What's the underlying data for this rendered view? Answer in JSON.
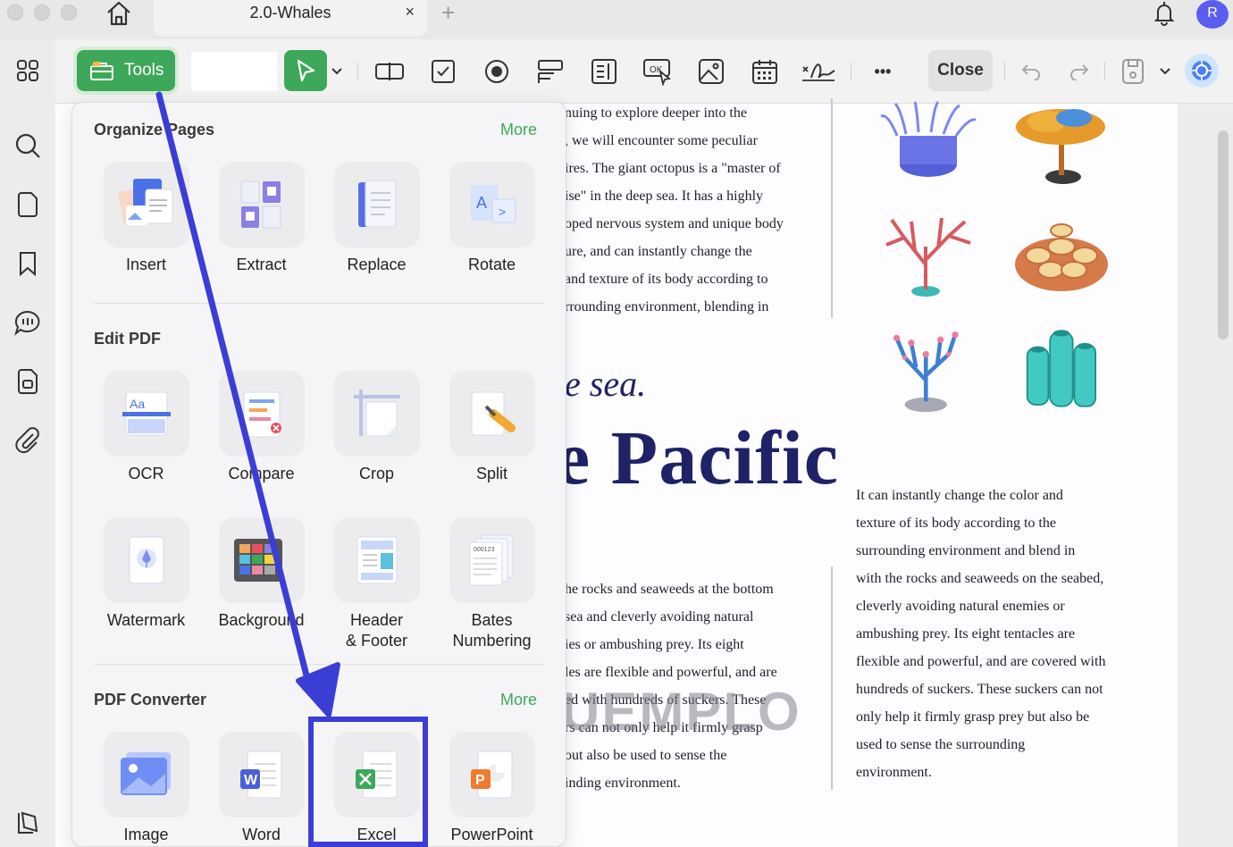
{
  "titlebar": {
    "tab_title": "2.0-Whales",
    "tab_close": "×",
    "new_tab": "+",
    "avatar_letter": "R",
    "icons": [
      "home-icon",
      "bell-icon"
    ]
  },
  "toolbar": {
    "tools_label": "Tools",
    "close_label": "Close",
    "more_label": "•••",
    "icons": [
      "select-arrow-icon",
      "text-field-icon",
      "checkbox-icon",
      "radio-button-icon",
      "combo-box-icon",
      "list-box-icon",
      "button-icon",
      "image-field-icon",
      "date-field-icon",
      "signature-field-icon",
      "undo-icon",
      "redo-icon",
      "save-icon",
      "ai-assistant-icon"
    ]
  },
  "rail": {
    "icons": [
      "grid-icon",
      "search-icon",
      "page-icon",
      "bookmark-icon",
      "comment-icon",
      "attachment-page-icon",
      "paperclip-icon",
      "layers-icon"
    ]
  },
  "panel": {
    "organize": {
      "title": "Organize Pages",
      "more": "More",
      "tools": [
        "Insert",
        "Extract",
        "Replace",
        "Rotate"
      ]
    },
    "edit": {
      "title": "Edit PDF",
      "tools": [
        "OCR",
        "Compare",
        "Crop",
        "Split",
        "Watermark",
        "Background",
        "Header\n& Footer",
        "Bates\nNumbering"
      ]
    },
    "converter": {
      "title": "PDF Converter",
      "more": "More",
      "tools": [
        "Image",
        "Word",
        "Excel",
        "PowerPoint"
      ]
    }
  },
  "document": {
    "top_lines": [
      "nuing to explore deeper into the",
      ", we will encounter some peculiar",
      "ires. The giant octopus is a \"master of",
      "ise\" in the deep sea. It has a highly",
      "oped nervous system and unique body",
      "ure, and can instantly change the",
      "and texture of its body according to",
      "rrounding environment, blending in"
    ],
    "sea_heading": "e sea.",
    "pacific_heading": "e Pacific",
    "mid_lines": [
      "he rocks and seaweeds at the bottom",
      " sea and cleverly avoiding natural",
      "ies or ambushing prey. Its eight",
      "les are flexible and powerful, and are",
      "ed with hundreds of suckers. These",
      "rs can not only help it firmly grasp",
      "out also be used to sense the",
      "inding environment."
    ],
    "right_lines": [
      "It can instantly change the color and",
      "texture of its body according to the",
      "surrounding environment and blend in",
      "with the rocks and seaweeds on the seabed,",
      "cleverly avoiding natural enemies or",
      "ambushing prey. Its eight tentacles are",
      "flexible and powerful, and are covered with",
      "hundreds of suckers. These suckers can not",
      "only help it firmly grasp prey but also be",
      "used to sense the surrounding",
      "environment."
    ],
    "watermark": "UEMPLO"
  },
  "annotation": {
    "color": "#3b3ed4"
  }
}
